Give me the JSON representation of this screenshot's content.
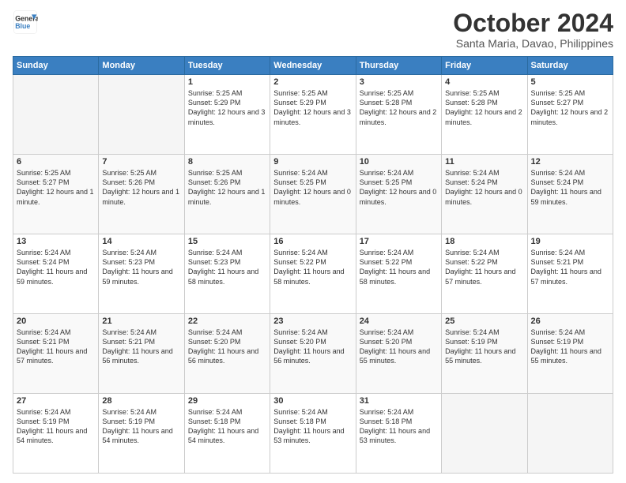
{
  "logo": {
    "line1": "General",
    "line2": "Blue"
  },
  "title": "October 2024",
  "subtitle": "Santa Maria, Davao, Philippines",
  "days_header": [
    "Sunday",
    "Monday",
    "Tuesday",
    "Wednesday",
    "Thursday",
    "Friday",
    "Saturday"
  ],
  "weeks": [
    [
      {
        "day": "",
        "empty": true
      },
      {
        "day": "",
        "empty": true
      },
      {
        "day": "1",
        "sunrise": "5:25 AM",
        "sunset": "5:29 PM",
        "daylight": "12 hours and 3 minutes."
      },
      {
        "day": "2",
        "sunrise": "5:25 AM",
        "sunset": "5:29 PM",
        "daylight": "12 hours and 3 minutes."
      },
      {
        "day": "3",
        "sunrise": "5:25 AM",
        "sunset": "5:28 PM",
        "daylight": "12 hours and 2 minutes."
      },
      {
        "day": "4",
        "sunrise": "5:25 AM",
        "sunset": "5:28 PM",
        "daylight": "12 hours and 2 minutes."
      },
      {
        "day": "5",
        "sunrise": "5:25 AM",
        "sunset": "5:27 PM",
        "daylight": "12 hours and 2 minutes."
      }
    ],
    [
      {
        "day": "6",
        "sunrise": "5:25 AM",
        "sunset": "5:27 PM",
        "daylight": "12 hours and 1 minute."
      },
      {
        "day": "7",
        "sunrise": "5:25 AM",
        "sunset": "5:26 PM",
        "daylight": "12 hours and 1 minute."
      },
      {
        "day": "8",
        "sunrise": "5:25 AM",
        "sunset": "5:26 PM",
        "daylight": "12 hours and 1 minute."
      },
      {
        "day": "9",
        "sunrise": "5:24 AM",
        "sunset": "5:25 PM",
        "daylight": "12 hours and 0 minutes."
      },
      {
        "day": "10",
        "sunrise": "5:24 AM",
        "sunset": "5:25 PM",
        "daylight": "12 hours and 0 minutes."
      },
      {
        "day": "11",
        "sunrise": "5:24 AM",
        "sunset": "5:24 PM",
        "daylight": "12 hours and 0 minutes."
      },
      {
        "day": "12",
        "sunrise": "5:24 AM",
        "sunset": "5:24 PM",
        "daylight": "11 hours and 59 minutes."
      }
    ],
    [
      {
        "day": "13",
        "sunrise": "5:24 AM",
        "sunset": "5:24 PM",
        "daylight": "11 hours and 59 minutes."
      },
      {
        "day": "14",
        "sunrise": "5:24 AM",
        "sunset": "5:23 PM",
        "daylight": "11 hours and 59 minutes."
      },
      {
        "day": "15",
        "sunrise": "5:24 AM",
        "sunset": "5:23 PM",
        "daylight": "11 hours and 58 minutes."
      },
      {
        "day": "16",
        "sunrise": "5:24 AM",
        "sunset": "5:22 PM",
        "daylight": "11 hours and 58 minutes."
      },
      {
        "day": "17",
        "sunrise": "5:24 AM",
        "sunset": "5:22 PM",
        "daylight": "11 hours and 58 minutes."
      },
      {
        "day": "18",
        "sunrise": "5:24 AM",
        "sunset": "5:22 PM",
        "daylight": "11 hours and 57 minutes."
      },
      {
        "day": "19",
        "sunrise": "5:24 AM",
        "sunset": "5:21 PM",
        "daylight": "11 hours and 57 minutes."
      }
    ],
    [
      {
        "day": "20",
        "sunrise": "5:24 AM",
        "sunset": "5:21 PM",
        "daylight": "11 hours and 57 minutes."
      },
      {
        "day": "21",
        "sunrise": "5:24 AM",
        "sunset": "5:21 PM",
        "daylight": "11 hours and 56 minutes."
      },
      {
        "day": "22",
        "sunrise": "5:24 AM",
        "sunset": "5:20 PM",
        "daylight": "11 hours and 56 minutes."
      },
      {
        "day": "23",
        "sunrise": "5:24 AM",
        "sunset": "5:20 PM",
        "daylight": "11 hours and 56 minutes."
      },
      {
        "day": "24",
        "sunrise": "5:24 AM",
        "sunset": "5:20 PM",
        "daylight": "11 hours and 55 minutes."
      },
      {
        "day": "25",
        "sunrise": "5:24 AM",
        "sunset": "5:19 PM",
        "daylight": "11 hours and 55 minutes."
      },
      {
        "day": "26",
        "sunrise": "5:24 AM",
        "sunset": "5:19 PM",
        "daylight": "11 hours and 55 minutes."
      }
    ],
    [
      {
        "day": "27",
        "sunrise": "5:24 AM",
        "sunset": "5:19 PM",
        "daylight": "11 hours and 54 minutes."
      },
      {
        "day": "28",
        "sunrise": "5:24 AM",
        "sunset": "5:19 PM",
        "daylight": "11 hours and 54 minutes."
      },
      {
        "day": "29",
        "sunrise": "5:24 AM",
        "sunset": "5:18 PM",
        "daylight": "11 hours and 54 minutes."
      },
      {
        "day": "30",
        "sunrise": "5:24 AM",
        "sunset": "5:18 PM",
        "daylight": "11 hours and 53 minutes."
      },
      {
        "day": "31",
        "sunrise": "5:24 AM",
        "sunset": "5:18 PM",
        "daylight": "11 hours and 53 minutes."
      },
      {
        "day": "",
        "empty": true
      },
      {
        "day": "",
        "empty": true
      }
    ]
  ],
  "labels": {
    "sunrise": "Sunrise:",
    "sunset": "Sunset:",
    "daylight": "Daylight:"
  }
}
